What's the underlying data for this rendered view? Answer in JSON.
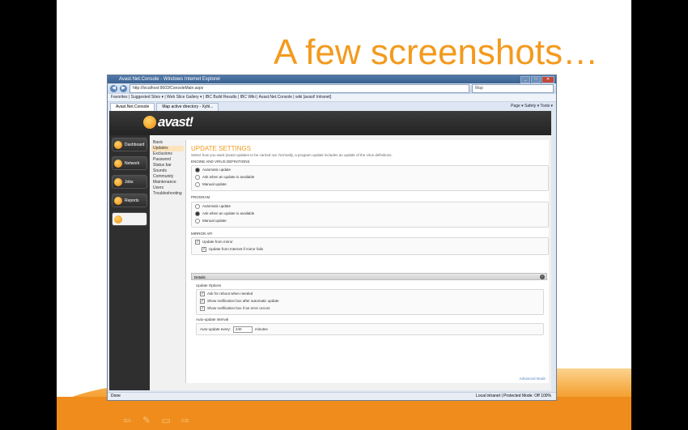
{
  "slide": {
    "title": "A few screenshots…",
    "nav_icons": [
      "back-arrow-icon",
      "pen-icon",
      "slide-icon",
      "forward-arrow-icon"
    ]
  },
  "browser": {
    "window_title": "Avast.Net.Console - Windows Internet Explorer",
    "address": "http://localhost:9603/ConsoleMain.aspx",
    "search_text": "Map",
    "favorites": "Favorites  |  Suggested Sites ▾  |  Web Slice Gallery ▾  |  IBC Build Results  |  IBC Wiki  |  Avast.Net.Console  |  wiki [avast! Intranet]",
    "tabs": [
      "Avast.Net.Console",
      "Map active directory - Xyhl..."
    ],
    "command_bar": "Page ▾  Safety ▾  Tools ▾",
    "status_left": "Done",
    "status_right": "Local intranet | Protected Mode: Off     100%"
  },
  "app": {
    "logo_text": "avast!",
    "left_nav": [
      "Dashboard",
      "Network",
      "Jobs",
      "Reports",
      ""
    ],
    "submenu": [
      "Basic",
      "Updates",
      "Exclusions",
      "Password",
      "Status bar",
      "Sounds",
      "Community",
      "Maintenance",
      "Users",
      "Troubleshooting"
    ],
    "panel": {
      "title": "UPDATE SETTINGS",
      "description": "Select how you want (avast updates to be carried out. Normally, a program update includes an update of the virus definitions.",
      "engine_heading": "ENGINE AND VIRUS DEFINITIONS",
      "engine_options": [
        "Automatic update",
        "Ask when an update is available",
        "Manual update"
      ],
      "program_heading": "PROGRAM",
      "program_options": [
        "Automatic update",
        "Ask when an update is available",
        "Manual update"
      ],
      "mirror_heading": "MIRROR API",
      "mirror_options": [
        "Update from mirror",
        "Update from Internet if mirror fails"
      ],
      "details_label": "Details",
      "update_options_heading": "Update Options",
      "update_options": [
        "Ask for reboot when needed",
        "Show notification box after automatic update",
        "Show notification box if an error occurs"
      ],
      "interval_heading": "Auto-update interval",
      "interval_label": "Auto-update every:",
      "interval_value": "240",
      "interval_unit": "minutes",
      "advanced_mode": "Advanced Mode"
    }
  }
}
